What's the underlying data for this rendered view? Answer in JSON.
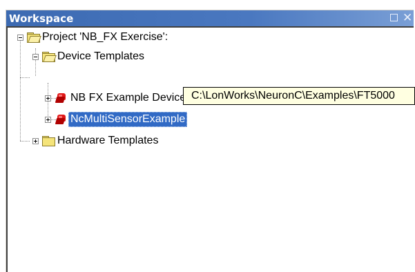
{
  "window": {
    "title": "Workspace"
  },
  "tree": {
    "project": {
      "label": "Project 'NB_FX Exercise':"
    },
    "device_templates": {
      "label": "Device Templates"
    },
    "items": [
      {
        "label": "NB FX Example Device"
      },
      {
        "label": "NcMultiSensorExample"
      }
    ],
    "hardware_templates": {
      "label": "Hardware Templates"
    }
  },
  "tooltip": {
    "text": "C:\\LonWorks\\NeuronC\\Examples\\FT5000"
  },
  "colors": {
    "titlebar": "#3c6ab2",
    "selection": "#316ac5",
    "tooltip_bg": "#ffffe1"
  }
}
